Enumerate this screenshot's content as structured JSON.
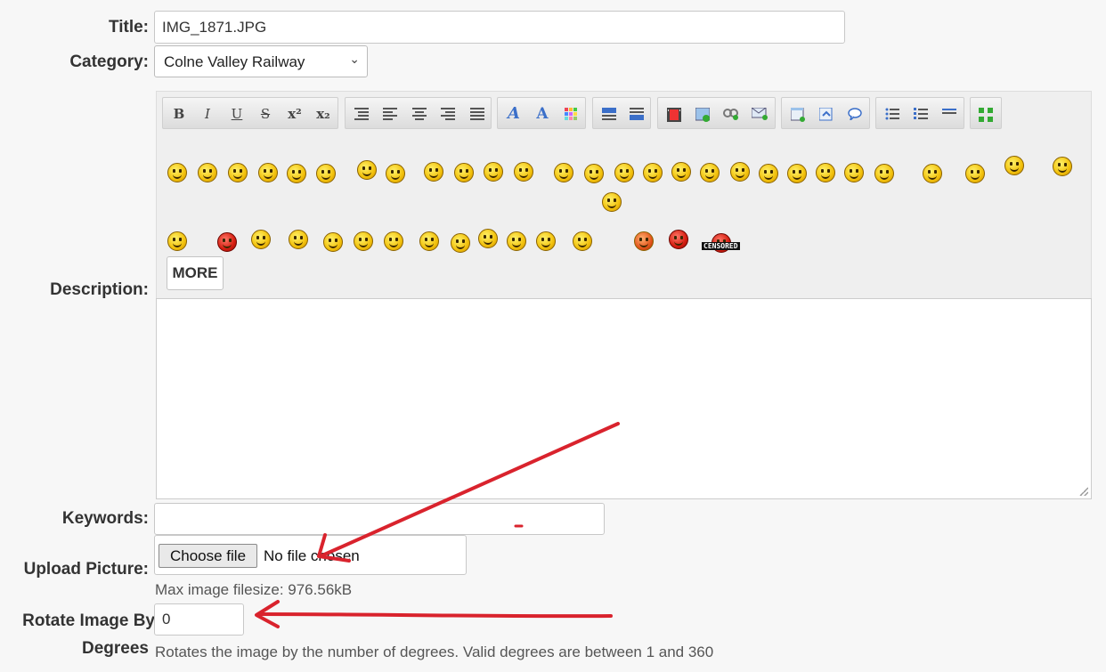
{
  "form": {
    "title_label": "Title:",
    "title_value": "IMG_1871.JPG",
    "category_label": "Category:",
    "category_value": "Colne Valley Railway",
    "description_label": "Description:",
    "keywords_label": "Keywords:",
    "keywords_value": "",
    "upload_label": "Upload Picture:",
    "choose_file_label": "Choose file",
    "no_file_text": "No file chosen",
    "max_filesize_text": "Max image filesize: 976.56kB",
    "rotate_label_line1": "Rotate Image By",
    "rotate_label_line2": "Degrees",
    "rotate_value": "0",
    "rotate_help": "Rotates the image by the number of degrees. Valid degrees are between 1 and 360"
  },
  "editor": {
    "more_label": "MORE",
    "format_buttons": [
      "B",
      "I",
      "U",
      "S",
      "x²",
      "x₂"
    ],
    "smiley_censored_text": "CENSORED"
  },
  "annotations": {
    "arrow_color": "#d9232d"
  },
  "icons": [
    "bold-icon",
    "italic-icon",
    "underline-icon",
    "strike-icon",
    "superscript-icon",
    "subscript-icon",
    "align-left-icon",
    "align-center-icon",
    "align-right-icon",
    "justify-icon",
    "font-icon",
    "font-size-icon",
    "color-icon",
    "image-icon",
    "link-icon",
    "email-icon",
    "list-icon",
    "ordered-list-icon",
    "horizontal-rule-icon",
    "fullscreen-icon",
    "chevron-down-icon"
  ]
}
